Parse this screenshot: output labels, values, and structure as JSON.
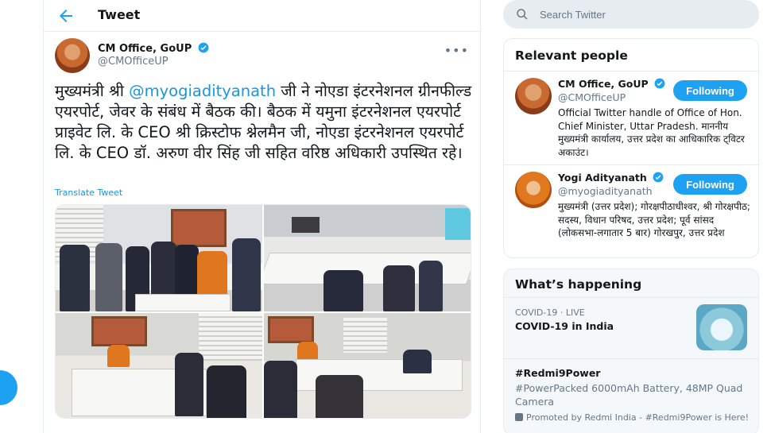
{
  "colors": {
    "accent": "#1da1f2",
    "link": "#1b95e0",
    "muted": "#657786"
  },
  "header": {
    "title": "Tweet"
  },
  "tweet": {
    "author_name": "CM Office, GoUP",
    "author_handle": "@CMOfficeUP",
    "text_before": "मुख्यमंत्री श्री ",
    "mention": "@myogiadityanath",
    "text_after": " जी ने नोएडा इंटरनेशनल ग्रीनफील्ड एयरपोर्ट, जेवर के संबंध में बैठक की। बैठक में यमुना इंटरनेशनल एयरपोर्ट प्राइवेट लि. के CEO श्री क्रिस्टोफ श्नेलमैन जी, नोएडा इंटरनेशनल एयरपोर्ट लि. के CEO डॉ. अरुण वीर सिंह जी सहित वरिष्ठ अधिकारी उपस्थित रहे।",
    "translate_label": "Translate Tweet",
    "photo_count": 4
  },
  "search": {
    "placeholder": "Search Twitter"
  },
  "relevant": {
    "title": "Relevant people",
    "people": [
      {
        "name": "CM Office, GoUP",
        "handle": "@CMOfficeUP",
        "button": "Following",
        "bio": "Official Twitter handle of Office of Hon. Chief Minister, Uttar Pradesh. माननीय मुख्यमंत्री कार्यालय, उत्तर प्रदेश का आधिकारिक ट्विटर अकाउंट।"
      },
      {
        "name": "Yogi Adityanath",
        "handle": "@myogiadityanath",
        "button": "Following",
        "bio": "मुख्यमंत्री (उत्तर प्रदेश); गोरक्षपीठाधीश्वर, श्री गोरक्षपीठ; सदस्य, विधान परिषद, उत्तर प्रदेश; पूर्व सांसद (लोकसभा-लगातार 5 बार) गोरखपुर, उत्तर प्रदेश"
      }
    ]
  },
  "happening": {
    "title": "What’s happening",
    "trends": [
      {
        "meta": "COVID-19 · LIVE",
        "title": "COVID-19 in India",
        "thumb_icon": "mask-image"
      },
      {
        "title": "#Redmi9Power",
        "description": "#PowerPacked 6000mAh Battery, 48MP Quad Camera",
        "promo": "Promoted by Redmi India - #Redmi9Power is Here!"
      }
    ]
  }
}
